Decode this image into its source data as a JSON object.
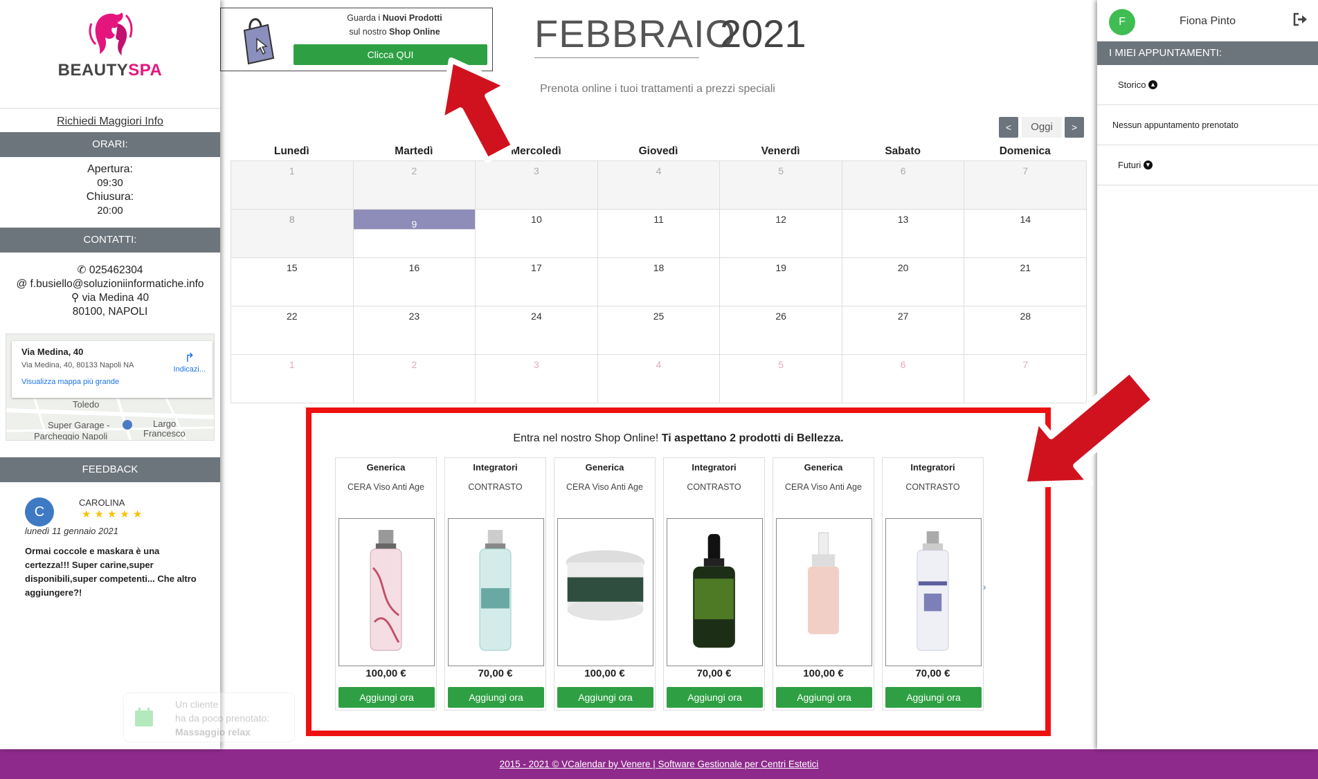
{
  "logo": {
    "brand_a": "BEAUTY",
    "brand_b": "SPA"
  },
  "left": {
    "info_link": "Richiedi Maggiori Info",
    "hours_header": "ORARI:",
    "open_label": "Apertura:",
    "open_time": "09:30",
    "close_label": "Chiusura:",
    "close_time": "20:00",
    "contacts_header": "CONTATTI:",
    "phone": "025462304",
    "email": "f.busiello@soluzioniinformatiche.info",
    "address": "via Medina 40",
    "city": "80100, NAPOLI",
    "map": {
      "title": "Via Medina, 40",
      "address": "Via Medina, 40, 80133 Napoli NA",
      "view_link": "Visualizza mappa più grande",
      "directions": "Indicazi...",
      "label_toledo": "Toledo",
      "label_garage": "Super Garage -",
      "label_parcheggio": "Parcheggio Napoli",
      "label_largo": "Largo",
      "label_francesco": "Francesco"
    },
    "feedback_header": "FEEDBACK",
    "review": {
      "initial": "C",
      "name": "CAROLINA",
      "stars": "★★★★★",
      "date": "lunedì 11 gennaio 2021",
      "text": "Ormai coccole e maskara è una certezza!!! Super carine,super disponibili,super competenti... Che altro aggiungere?!"
    }
  },
  "toast": {
    "line1": "Un cliente",
    "line2": "ha da poco prenotato:",
    "line3": "Massaggio relax"
  },
  "promo": {
    "line1a": "Guarda i ",
    "line1b": "Nuovi Prodotti",
    "line2a": "sul nostro ",
    "line2b": "Shop Online",
    "button": "Clicca QUI"
  },
  "calendar": {
    "month": "FEBBRAIO",
    "year": "2021",
    "subtitle": "Prenota online i tuoi trattamenti a prezzi speciali",
    "prev": "<",
    "today": "Oggi",
    "next": ">",
    "days": [
      "Lunedì",
      "Martedì",
      "Mercoledì",
      "Giovedì",
      "Venerdì",
      "Sabato",
      "Domenica"
    ],
    "weeks": [
      [
        "1",
        "2",
        "3",
        "4",
        "5",
        "6",
        "7"
      ],
      [
        "8",
        "9",
        "10",
        "11",
        "12",
        "13",
        "14"
      ],
      [
        "15",
        "16",
        "17",
        "18",
        "19",
        "20",
        "21"
      ],
      [
        "22",
        "23",
        "24",
        "25",
        "26",
        "27",
        "28"
      ],
      [
        "1",
        "2",
        "3",
        "4",
        "5",
        "6",
        "7"
      ]
    ]
  },
  "shop": {
    "title_a": "Entra nel nostro Shop Online! ",
    "title_b": "Ti aspettano 2 prodotti di Bellezza.",
    "products": [
      {
        "category": "Generica",
        "name": "CERA Viso Anti Age",
        "price": "100,00 €",
        "button": "Aggiungi ora"
      },
      {
        "category": "Integratori",
        "name": "CONTRASTO",
        "price": "70,00 €",
        "button": "Aggiungi ora"
      },
      {
        "category": "Generica",
        "name": "CERA Viso Anti Age",
        "price": "100,00 €",
        "button": "Aggiungi ora"
      },
      {
        "category": "Integratori",
        "name": "CONTRASTO",
        "price": "70,00 €",
        "button": "Aggiungi ora"
      },
      {
        "category": "Generica",
        "name": "CERA Viso Anti Age",
        "price": "100,00 €",
        "button": "Aggiungi ora"
      },
      {
        "category": "Integratori",
        "name": "CONTRASTO",
        "price": "70,00 €",
        "button": "Aggiungi ora"
      }
    ]
  },
  "right": {
    "initial": "F",
    "user_name": "Fiona Pinto",
    "header": "I MIEI APPUNTAMENTI:",
    "history": "Storico",
    "none": "Nessun appuntamento prenotato",
    "future": "Futuri"
  },
  "footer": {
    "text": "2015 - 2021 © VCalendar by Venere | Software Gestionale per Centri Estetici"
  },
  "icons": {
    "logo": "woman-face-logo-icon",
    "phone": "phone-icon",
    "email": "at-icon",
    "pin": "map-pin-icon",
    "bag": "shopping-bag-icon",
    "logout": "logout-icon",
    "calendar": "calendar-icon"
  },
  "colors": {
    "brand": "#e5157e",
    "green": "#2ea043",
    "header_gray": "#6c747c",
    "highlight": "#8e8cb8",
    "footer": "#8e2a8c",
    "frame": "#ee1111"
  }
}
